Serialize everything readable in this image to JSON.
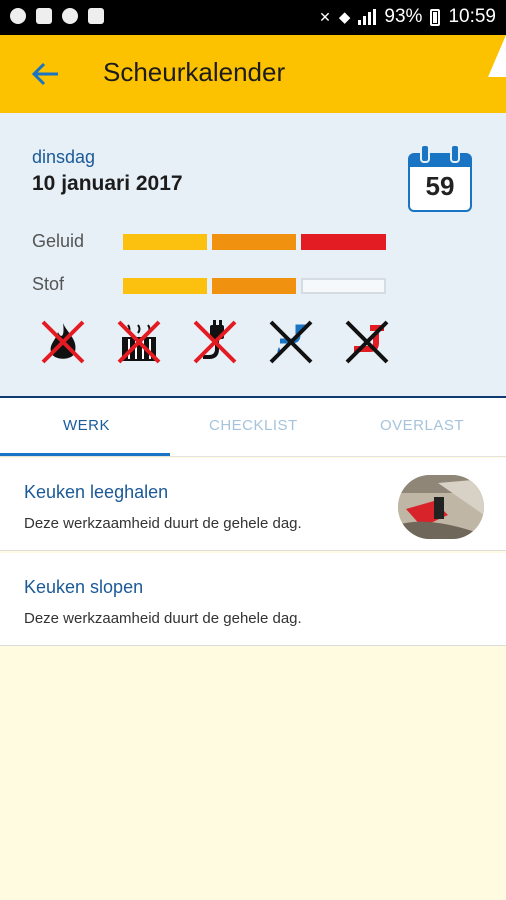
{
  "status_bar": {
    "battery": "93%",
    "time": "10:59"
  },
  "app_bar": {
    "title": "Scheurkalender"
  },
  "summary": {
    "day_name": "dinsdag",
    "date": "10 januari 2017",
    "calendar_number": "59",
    "metrics": [
      {
        "label": "Geluid",
        "level": 3,
        "max": 3
      },
      {
        "label": "Stof",
        "level": 2,
        "max": 3
      }
    ],
    "level_colors": [
      "#fcc10f",
      "#f0910f",
      "#e31b23"
    ],
    "hazard_icons": [
      {
        "name": "no-fire-icon",
        "color": "#111111"
      },
      {
        "name": "no-heating-icon",
        "color": "#111111"
      },
      {
        "name": "no-power-icon",
        "color": "#111111"
      },
      {
        "name": "no-water-icon",
        "color": "#1a74c4"
      },
      {
        "name": "no-gas-icon",
        "color": "#e31b23"
      }
    ]
  },
  "tabs": [
    {
      "label": "WERK",
      "active": true
    },
    {
      "label": "CHECKLIST",
      "active": false
    },
    {
      "label": "OVERLAST",
      "active": false
    }
  ],
  "tasks": [
    {
      "title": "Keuken leeghalen",
      "description": "Deze werkzaamheid duurt de gehele dag.",
      "has_image": true
    },
    {
      "title": "Keuken slopen",
      "description": "Deze werkzaamheid duurt de gehele dag.",
      "has_image": false
    }
  ]
}
